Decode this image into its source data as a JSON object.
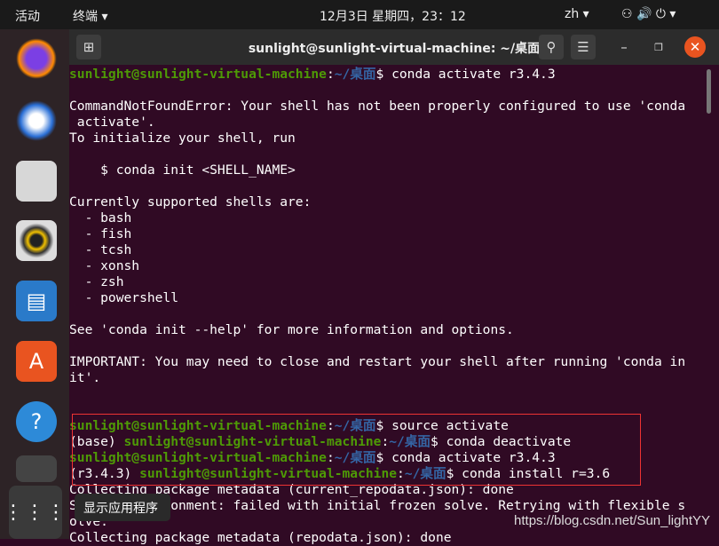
{
  "topbar": {
    "activities": "活动",
    "app_menu": "终端 ▾",
    "clock": "12月3日 星期四，23：12",
    "input_method": "zh ▾",
    "tray": "⚇ 🔊 ⏻ ▾"
  },
  "dock": {
    "items": [
      "firefox",
      "thunderbird",
      "files",
      "rhythmbox",
      "libreoffice-writer",
      "ubuntu-software",
      "help",
      "terminal",
      "show-applications"
    ],
    "tooltip": "显示应用程序"
  },
  "window": {
    "title": "sunlight@sunlight-virtual-machine: ~/桌面"
  },
  "terminal": {
    "user": "sunlight@sunlight-virtual-machine",
    "path": "~/桌面",
    "lines": [
      {
        "prefix": "",
        "prompt": true,
        "text": "conda activate r3.4.3"
      },
      {
        "text": ""
      },
      {
        "text": "CommandNotFoundError: Your shell has not been properly configured to use 'conda"
      },
      {
        "text": " activate'."
      },
      {
        "text": "To initialize your shell, run"
      },
      {
        "text": ""
      },
      {
        "text": "    $ conda init <SHELL_NAME>"
      },
      {
        "text": ""
      },
      {
        "text": "Currently supported shells are:"
      },
      {
        "text": "  - bash"
      },
      {
        "text": "  - fish"
      },
      {
        "text": "  - tcsh"
      },
      {
        "text": "  - xonsh"
      },
      {
        "text": "  - zsh"
      },
      {
        "text": "  - powershell"
      },
      {
        "text": ""
      },
      {
        "text": "See 'conda init --help' for more information and options."
      },
      {
        "text": ""
      },
      {
        "text": "IMPORTANT: You may need to close and restart your shell after running 'conda in"
      },
      {
        "text": "it'."
      },
      {
        "text": ""
      },
      {
        "text": ""
      },
      {
        "prefix": "",
        "prompt": true,
        "text": "source activate"
      },
      {
        "prefix": "(base) ",
        "prompt": true,
        "text": "conda deactivate"
      },
      {
        "prefix": "",
        "prompt": true,
        "text": "conda activate r3.4.3"
      },
      {
        "prefix": "(r3.4.3) ",
        "prompt": true,
        "text": "conda install r=3.6"
      },
      {
        "text": "Collecting package metadata (current_repodata.json): done"
      },
      {
        "text": "Solving environment: failed with initial frozen solve. Retrying with flexible s"
      },
      {
        "text": "olve."
      },
      {
        "text": "Collecting package metadata (repodata.json): done"
      }
    ]
  },
  "watermark": "https://blog.csdn.net/Sun_lightYY",
  "colors": {
    "bg": "#300a24",
    "user": "#4e9a06",
    "path": "#3465a4",
    "highlight": "#ee3333"
  }
}
